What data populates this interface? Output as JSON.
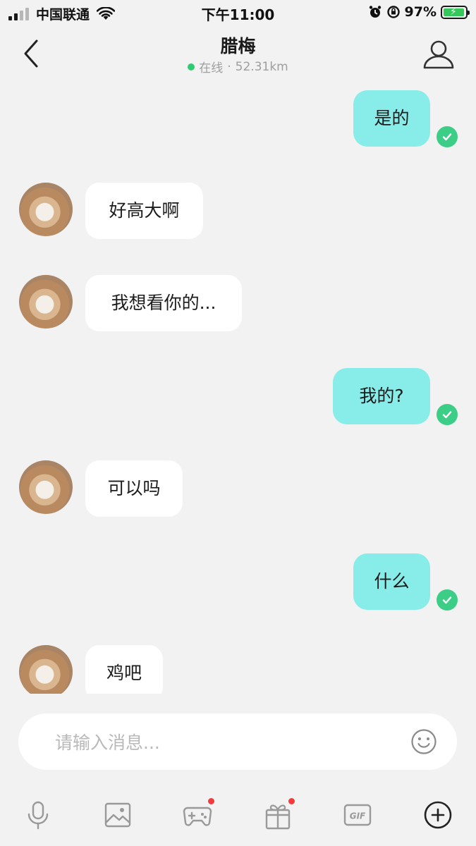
{
  "status_bar": {
    "carrier": "中国联通",
    "time": "下午11:00",
    "battery_percent": "97%",
    "battery_level": 0.97
  },
  "header": {
    "title": "腊梅",
    "status": "在线",
    "separator": "·",
    "distance": "52.31km"
  },
  "messages": [
    {
      "direction": "out",
      "text": "是的",
      "read": true
    },
    {
      "direction": "in",
      "text": "好高大啊"
    },
    {
      "direction": "in",
      "text": "我想看你的..."
    },
    {
      "direction": "out",
      "text": "我的?",
      "read": true
    },
    {
      "direction": "in",
      "text": "可以吗"
    },
    {
      "direction": "out",
      "text": "什么",
      "read": true
    },
    {
      "direction": "in",
      "text": "鸡吧"
    }
  ],
  "input": {
    "placeholder": "请输入消息..."
  },
  "toolbar": {
    "items": [
      {
        "icon": "microphone-icon"
      },
      {
        "icon": "image-icon"
      },
      {
        "icon": "game-icon",
        "badge": true
      },
      {
        "icon": "gift-icon",
        "badge": true
      },
      {
        "icon": "gif-icon",
        "label": "GIF"
      },
      {
        "icon": "plus-circle-icon"
      }
    ]
  },
  "colors": {
    "background": "#f3f2f3",
    "outgoing_bubble": "#88ece8",
    "incoming_bubble": "#ffffff",
    "read_check": "#3ccd86",
    "online": "#2ecc71",
    "badge": "#f23c3c"
  }
}
